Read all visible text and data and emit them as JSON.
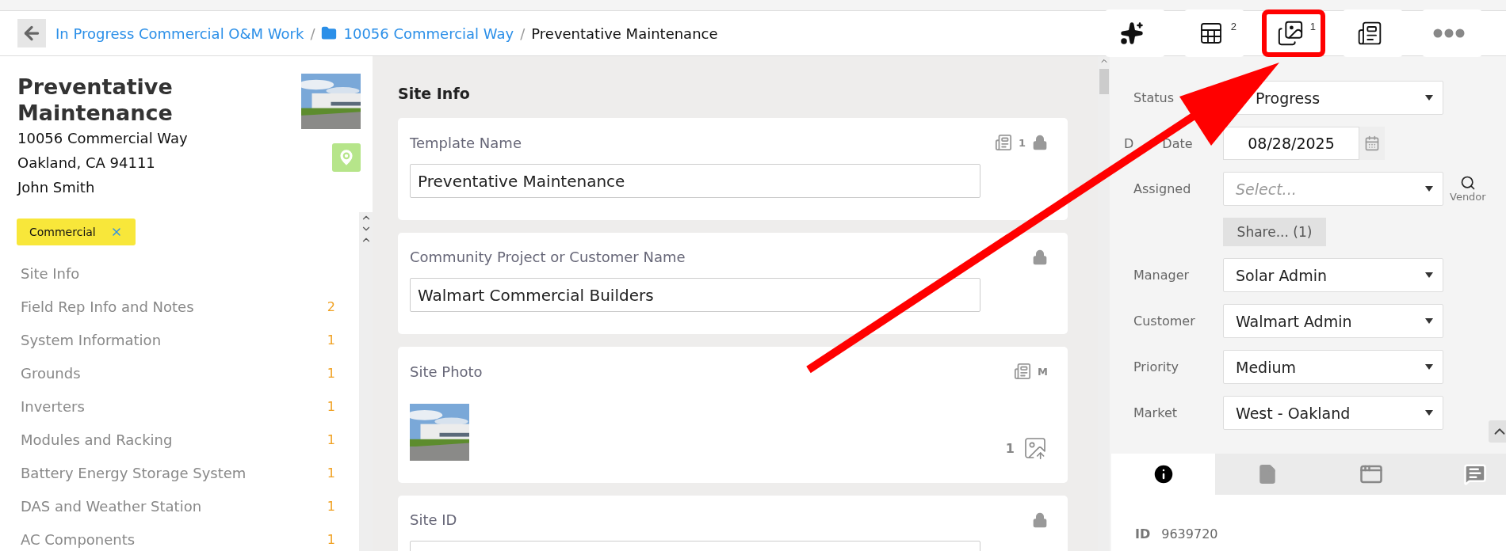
{
  "header": {
    "breadcrumbs": [
      {
        "label": "In Progress Commercial O&M Work",
        "kind": "link"
      },
      {
        "separator": "/",
        "label": "10056 Commercial Way",
        "kind": "folder"
      },
      {
        "separator": "/",
        "label": "Preventative Maintenance",
        "kind": "current"
      }
    ],
    "toolbar": [
      {
        "kind": "sparkle",
        "highlighted": false
      },
      {
        "kind": "table",
        "badge": "2",
        "highlighted": false
      },
      {
        "kind": "gallery",
        "badge": "1",
        "highlighted": true
      },
      {
        "kind": "document",
        "highlighted": false
      },
      {
        "kind": "more",
        "highlighted": false
      }
    ]
  },
  "record": {
    "title": "Preventative Maintenance",
    "address_lines": [
      "10056 Commercial Way",
      "Oakland, CA 94111"
    ],
    "contact": "John Smith",
    "tags": [
      {
        "label": "Commercial"
      }
    ]
  },
  "sections": [
    {
      "label": "Site Info"
    },
    {
      "label": "Field Rep Info and Notes",
      "count": "2"
    },
    {
      "label": "System Information",
      "count": "1"
    },
    {
      "label": "Grounds",
      "count": "1"
    },
    {
      "label": "Inverters",
      "count": "1"
    },
    {
      "label": "Modules and Racking",
      "count": "1"
    },
    {
      "label": "Battery Energy Storage System",
      "count": "1"
    },
    {
      "label": "DAS and Weather Station",
      "count": "1"
    },
    {
      "label": "AC Components",
      "count": "1"
    }
  ],
  "form": {
    "title": "Site Info",
    "cards": [
      {
        "label": "Template Name",
        "kind": "text",
        "value": "Preventative Maintenance",
        "locked": true,
        "note_badge": "1"
      },
      {
        "label": "Community Project or Customer Name",
        "kind": "text",
        "value": "Walmart Commercial Builders",
        "locked": true
      },
      {
        "label": "Site Photo",
        "locked": false,
        "note_badge": "M",
        "photo_count": "1"
      },
      {
        "label": "Site ID",
        "kind": "text",
        "locked": true
      }
    ]
  },
  "details": {
    "fields": [
      {
        "kind": "select",
        "label": "Status",
        "value": "Progress"
      },
      {
        "kind": "date",
        "label_parts": [
          "D",
          "Date"
        ],
        "value": "08/28/2025"
      },
      {
        "kind": "select",
        "label": "Assigned",
        "placeholder": "Select...",
        "action": "Vendor"
      },
      {
        "kind": "button",
        "label": "Share... (1)"
      },
      {
        "kind": "select",
        "label": "Manager",
        "value": "Solar Admin"
      },
      {
        "kind": "select",
        "label": "Customer",
        "value": "Walmart Admin"
      },
      {
        "kind": "select",
        "label": "Priority",
        "value": "Medium"
      },
      {
        "kind": "select",
        "label": "Market",
        "value": "West - Oakland"
      }
    ]
  },
  "tabs": [
    {
      "kind": "info",
      "selected": true
    },
    {
      "kind": "file",
      "selected": false
    },
    {
      "kind": "window",
      "selected": false
    },
    {
      "kind": "comment",
      "selected": false
    }
  ],
  "info": {
    "id_label": "ID",
    "id_value": "9639720"
  }
}
